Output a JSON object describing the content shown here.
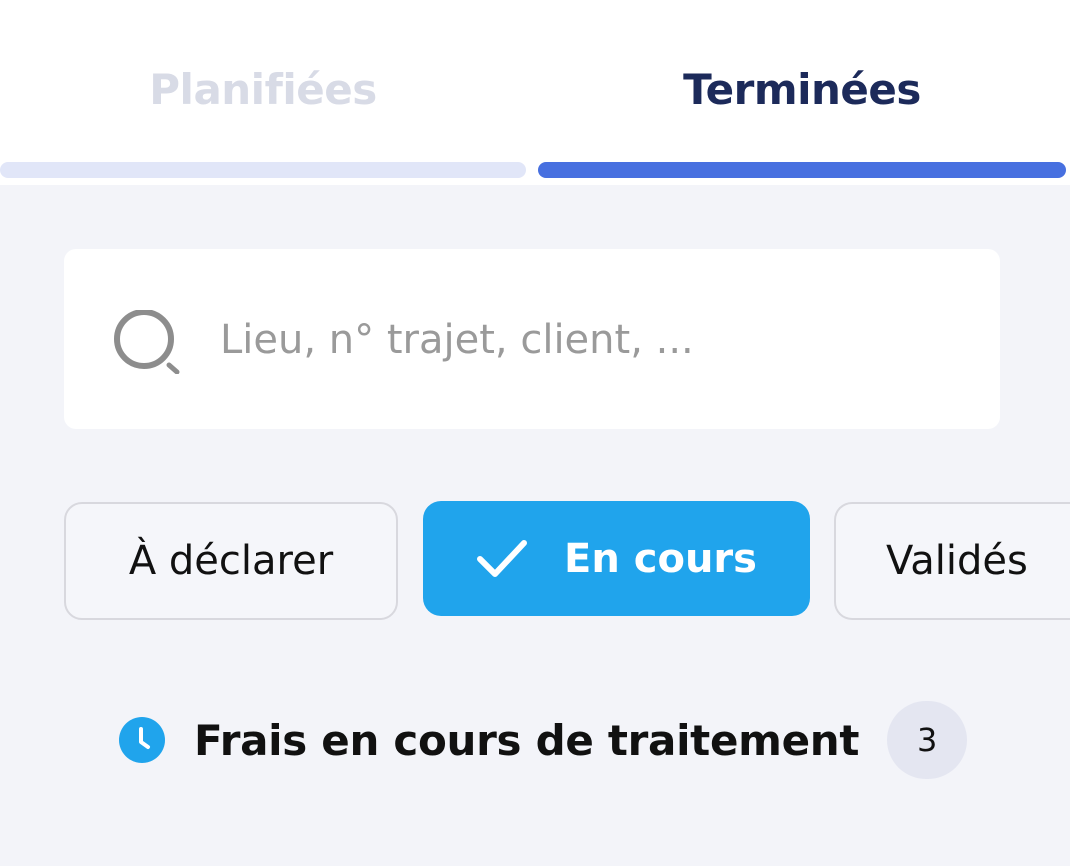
{
  "tabs": [
    {
      "label": "Planifiées",
      "active": false
    },
    {
      "label": "Terminées",
      "active": true
    }
  ],
  "search": {
    "placeholder": "Lieu, n° trajet, client, ...",
    "value": "",
    "icon": "search-icon"
  },
  "filters": [
    {
      "label": "À déclarer",
      "selected": false
    },
    {
      "label": "En cours",
      "selected": true,
      "icon": "check-icon"
    },
    {
      "label": "Validés",
      "selected": false
    }
  ],
  "status": {
    "icon": "clock-icon",
    "label": "Frais en cours de traitement",
    "count": "3"
  },
  "colors": {
    "active_tab_text": "#1c2a5a",
    "inactive_tab_text": "#d8dbe6",
    "active_tab_bar": "#4770e0",
    "inactive_tab_bar": "#e1e6f8",
    "selected_chip": "#20a4ec",
    "clock_icon": "#20a4ec",
    "background": "#f3f4f9"
  }
}
